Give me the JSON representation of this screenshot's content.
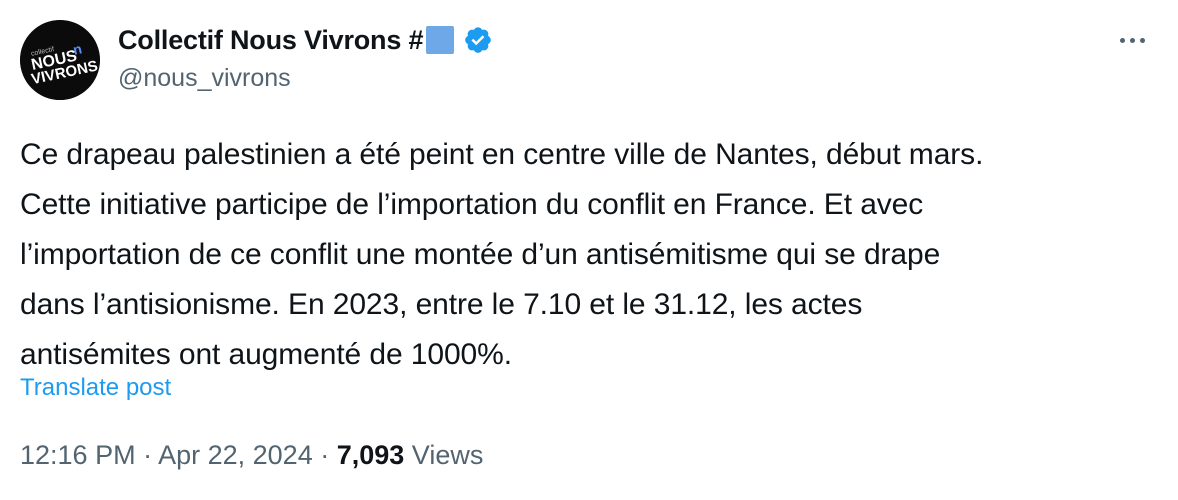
{
  "author": {
    "display_name": "Collectif Nous Vivrons #",
    "handle": "@nous_vivrons",
    "verified_icon": "verified-badge-icon",
    "flag_emoji_color": "#6fa8e8",
    "avatar": {
      "small_text": "collectif",
      "line1": "NOUS",
      "line2": "VIVRONS",
      "accent_glyph": "n",
      "accent_color": "#5b8ff9"
    }
  },
  "menu": {
    "icon": "more-horizontal-icon"
  },
  "tweet": {
    "lines": [
      "Ce drapeau palestinien a été peint en centre ville de Nantes, début mars.",
      "Cette initiative participe de l’importation du conflit en France. Et avec",
      "l’importation de ce conflit une montée d’un antisémitisme qui se drape",
      "dans l’antisionisme. En 2023, entre le 7.10 et le 31.12, les actes",
      "antisémites ont augmenté de 1000%."
    ],
    "translate_label": "Translate post"
  },
  "meta": {
    "time": "12:16 PM",
    "separator": " · ",
    "date": "Apr 22, 2024",
    "views_count": "7,093",
    "views_label": " Views"
  },
  "colors": {
    "text": "#0f1419",
    "secondary": "#536471",
    "link": "#1d9bf0",
    "verified": "#1d9bf0"
  }
}
